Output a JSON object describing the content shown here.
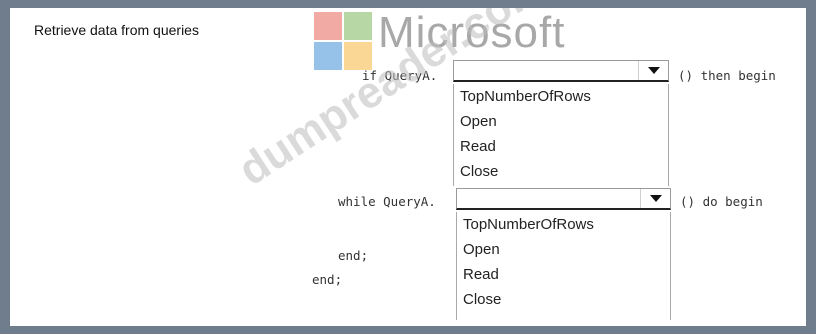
{
  "title": "Retrieve data from queries",
  "logo": {
    "text": "Microsoft",
    "squares": [
      "#e8655b",
      "#7bb85a",
      "#3f8fd8",
      "#f6b73c"
    ]
  },
  "watermark": "dumpreader.com",
  "code": {
    "line1_prefix": "if QueryA.",
    "line1_suffix": "() then begin",
    "line2_prefix": "while QueryA.",
    "line2_suffix": "() do begin",
    "end_inner": "end;",
    "end_outer": "end;"
  },
  "select1": {
    "value": "",
    "options": [
      "TopNumberOfRows",
      "Open",
      "Read",
      "Close"
    ]
  },
  "select2": {
    "value": "",
    "options": [
      "TopNumberOfRows",
      "Open",
      "Read",
      "Close"
    ]
  }
}
